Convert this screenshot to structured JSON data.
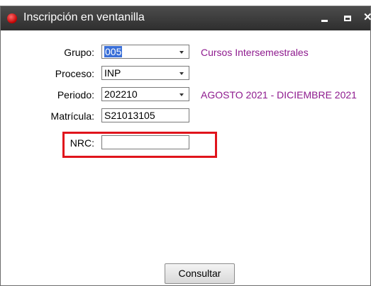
{
  "window": {
    "title": "Inscripción en ventanilla"
  },
  "form": {
    "grupo": {
      "label": "Grupo:",
      "value": "005",
      "note": "Cursos Intersemestrales"
    },
    "proceso": {
      "label": "Proceso:",
      "value": "INP"
    },
    "periodo": {
      "label": "Periodo:",
      "value": "202210",
      "note": "AGOSTO 2021 - DICIEMBRE 2021"
    },
    "matricula": {
      "label": "Matrícula:",
      "value": "S21013105"
    },
    "nrc": {
      "label": "NRC:",
      "value": ""
    }
  },
  "buttons": {
    "consultar": "Consultar"
  },
  "colors": {
    "note_text": "#8e1a8e",
    "highlight_border": "#e0141c",
    "titlebar": "#3a3a3a"
  }
}
